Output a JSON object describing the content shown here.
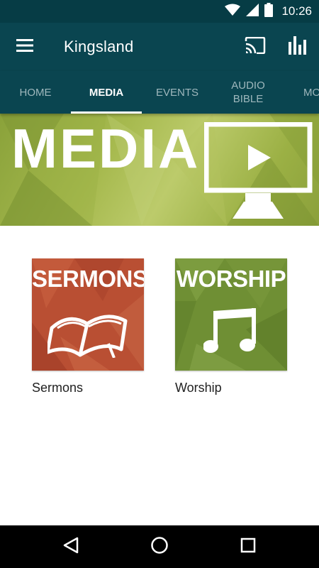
{
  "status_bar": {
    "time": "10:26",
    "icons": [
      "wifi-icon",
      "cellular-signal-icon",
      "battery-icon"
    ]
  },
  "app_bar": {
    "title": "Kingsland",
    "icons": [
      "menu-icon",
      "cast-icon",
      "stats-icon"
    ]
  },
  "tabs": [
    {
      "label": "HOME",
      "active": false
    },
    {
      "label": "MEDIA",
      "active": true
    },
    {
      "label": "EVENTS",
      "active": false
    },
    {
      "label": "AUDIO\nBIBLE",
      "active": false
    },
    {
      "label": "MO",
      "active": false
    }
  ],
  "banner": {
    "title": "MEDIA",
    "icon": "monitor-play-icon"
  },
  "media_items": [
    {
      "thumb_title": "SERMONS",
      "label": "Sermons",
      "icon": "open-book-icon",
      "color": "#b94f33"
    },
    {
      "thumb_title": "WORSHIP",
      "label": "Worship",
      "icon": "music-note-icon",
      "color": "#6f8f34"
    }
  ],
  "nav_bar": {
    "icons": [
      "back-icon",
      "home-icon",
      "recents-icon"
    ]
  },
  "colors": {
    "primary": "#0a4550",
    "status_bar": "#063c45",
    "banner_green": "#a7ba4f"
  }
}
